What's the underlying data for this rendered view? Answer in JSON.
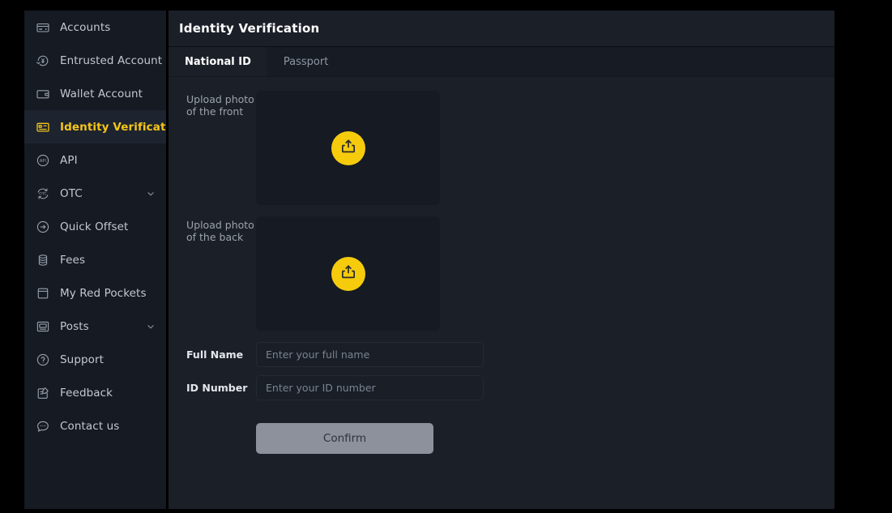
{
  "theme": {
    "accent": "#f5c518",
    "upload_button_bg": "#f5cb0c",
    "sidebar_bg": "#151a23",
    "panel_bg": "#1b2028",
    "active_nav_bg": "#1d2430",
    "page_bg": "#000000",
    "confirm_bg": "#8d919b"
  },
  "sidebar": {
    "items": [
      {
        "label": "Accounts",
        "icon": "card-icon",
        "active": false,
        "expandable": false
      },
      {
        "label": "Entrusted Account",
        "icon": "yen-circle-icon",
        "active": false,
        "expandable": false
      },
      {
        "label": "Wallet Account",
        "icon": "wallet-icon",
        "active": false,
        "expandable": false
      },
      {
        "label": "Identity Verification",
        "icon": "id-card-icon",
        "active": true,
        "expandable": false
      },
      {
        "label": "API",
        "icon": "api-circle-icon",
        "active": false,
        "expandable": false
      },
      {
        "label": "OTC",
        "icon": "otc-refresh-icon",
        "active": false,
        "expandable": true
      },
      {
        "label": "Quick Offset",
        "icon": "arrow-right-circle-icon",
        "active": false,
        "expandable": false
      },
      {
        "label": "Fees",
        "icon": "coins-stack-icon",
        "active": false,
        "expandable": false
      },
      {
        "label": "My Red Pockets",
        "icon": "envelope-icon",
        "active": false,
        "expandable": false
      },
      {
        "label": "Posts",
        "icon": "monitor-icon",
        "active": false,
        "expandable": true
      },
      {
        "label": "Support",
        "icon": "question-circle-icon",
        "active": false,
        "expandable": false
      },
      {
        "label": "Feedback",
        "icon": "edit-note-icon",
        "active": false,
        "expandable": false
      },
      {
        "label": "Contact us",
        "icon": "chat-bubble-icon",
        "active": false,
        "expandable": false
      }
    ]
  },
  "header": {
    "title": "Identity Verification"
  },
  "tabs": [
    {
      "label": "National ID",
      "active": true
    },
    {
      "label": "Passport",
      "active": false
    }
  ],
  "form": {
    "upload_front": {
      "label": "Upload photo of the front",
      "icon": "upload-box-arrow-icon"
    },
    "upload_back": {
      "label": "Upload photo of the back",
      "icon": "upload-box-arrow-icon"
    },
    "full_name": {
      "label": "Full Name",
      "placeholder": "Enter your full name",
      "value": ""
    },
    "id_number": {
      "label": "ID Number",
      "placeholder": "Enter your ID number",
      "value": ""
    },
    "confirm_label": "Confirm"
  }
}
